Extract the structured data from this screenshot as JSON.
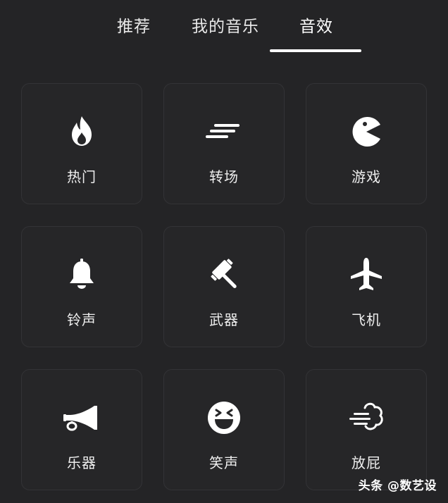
{
  "tabs": [
    {
      "label": "推荐"
    },
    {
      "label": "我的音乐"
    },
    {
      "label": "音效",
      "active": true
    }
  ],
  "categories": [
    {
      "label": "热门",
      "icon": "flame-icon"
    },
    {
      "label": "转场",
      "icon": "speed-lines-icon"
    },
    {
      "label": "游戏",
      "icon": "pacman-icon"
    },
    {
      "label": "铃声",
      "icon": "bell-icon"
    },
    {
      "label": "武器",
      "icon": "hammer-icon"
    },
    {
      "label": "飞机",
      "icon": "airplane-icon"
    },
    {
      "label": "乐器",
      "icon": "horn-icon"
    },
    {
      "label": "笑声",
      "icon": "laughing-face-icon"
    },
    {
      "label": "放屁",
      "icon": "gust-cloud-icon"
    }
  ],
  "watermark": "头条 @数艺设",
  "colors": {
    "background": "#242426",
    "tile_border": "#333336",
    "text": "#eeeeee",
    "indicator": "#ffffff"
  }
}
